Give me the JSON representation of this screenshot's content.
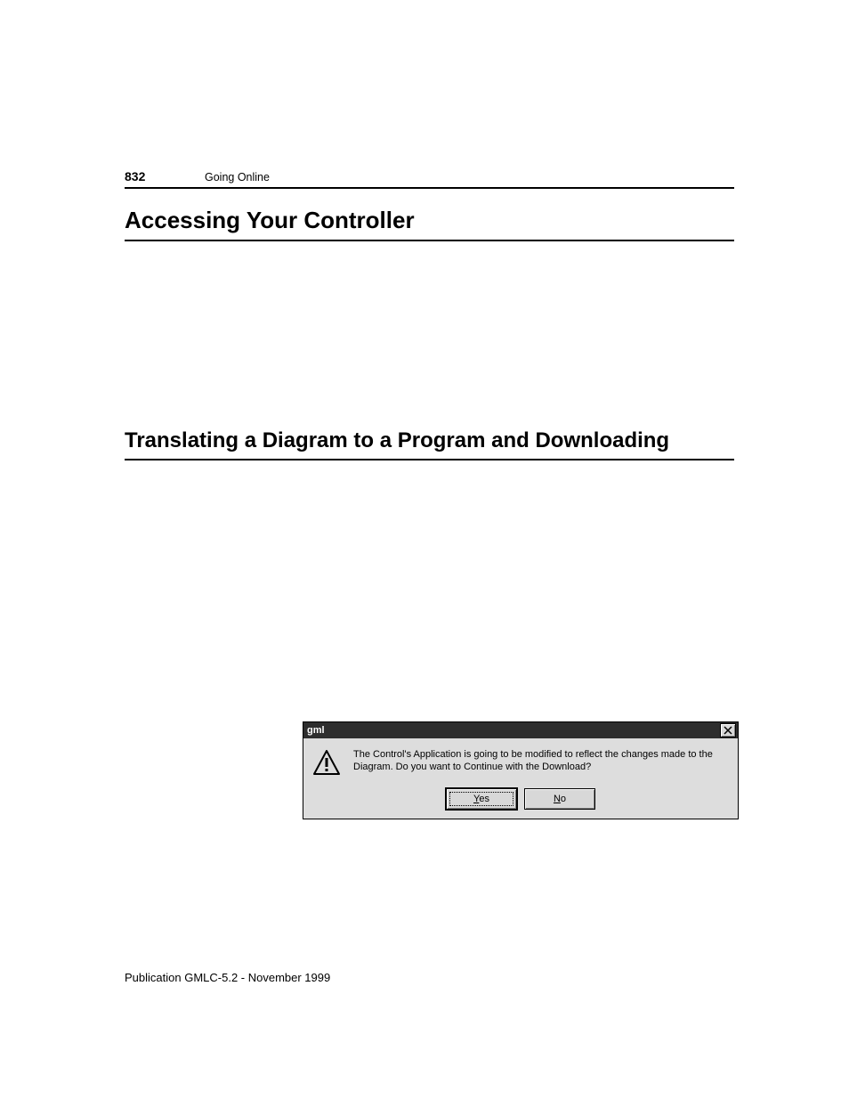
{
  "header": {
    "page_number": "832",
    "running_title": "Going Online"
  },
  "section_title_1": "Accessing Your Controller",
  "section_title_2": "Translating a Diagram to a Program and Downloading",
  "dialog": {
    "title": "gml",
    "message": "The Control's Application is going to be modified to reflect the changes made to the Diagram. Do you want to Continue with the Download?",
    "yes_rest": "es",
    "no_rest": "o"
  },
  "footer": {
    "publication": "Publication GMLC-5.2 - November 1999"
  }
}
